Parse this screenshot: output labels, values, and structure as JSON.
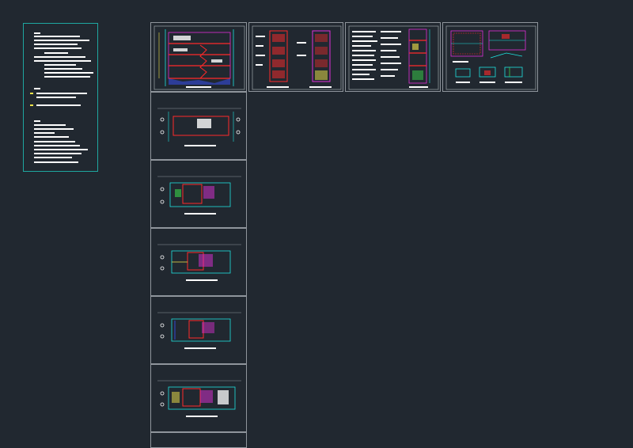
{
  "viewport": {
    "name": "model-space",
    "background": "#212830"
  },
  "notes_panel": {
    "border_color": "#1fa7a0",
    "text_color": "#ffffff",
    "marker_color": "#f4e64a"
  },
  "sheets": {
    "top_row": [
      {
        "name": "section-sheet",
        "kind": "building-section"
      },
      {
        "name": "elevation-sheet",
        "kind": "facade-elevations"
      },
      {
        "name": "side-elevation-sheet",
        "kind": "side-elevation-with-notes"
      },
      {
        "name": "detail-sheet",
        "kind": "details"
      }
    ],
    "plan_column": [
      {
        "name": "floor-plan-1"
      },
      {
        "name": "floor-plan-2"
      },
      {
        "name": "floor-plan-3"
      },
      {
        "name": "floor-plan-4"
      },
      {
        "name": "floor-plan-5"
      }
    ]
  },
  "palette": {
    "frame": "#8f959c",
    "cyan": "#1ee3e0",
    "red": "#ff2a2a",
    "magenta": "#e02fd8",
    "yellow": "#f4e64a",
    "white": "#ffffff",
    "blue": "#3a52ff",
    "green": "#39d44a"
  }
}
